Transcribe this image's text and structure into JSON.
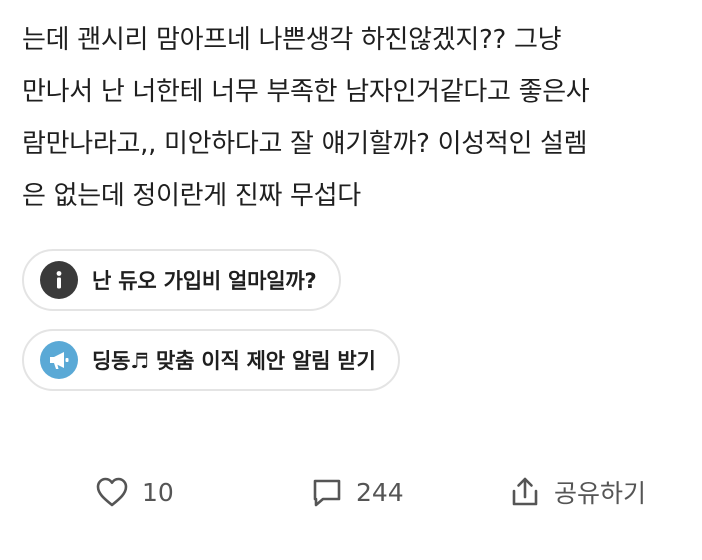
{
  "post": {
    "lines": [
      "는데 괜시리 맘아프네 나쁜생각 하진않겠지??  그냥",
      "만나서 난 너한테 너무 부족한 남자인거같다고 좋은사",
      "람만나라고,, 미안하다고 잘 얘기할까? 이성적인 설렘",
      "은 없는데 정이란게 진짜 무섭다"
    ]
  },
  "chips": [
    {
      "label": "난 듀오 가입비 얼마일까?",
      "icon": "info-icon",
      "icon_bg": "#3a3a3a"
    },
    {
      "label": "딩동♬ 맞춤 이직 제안 알림 받기",
      "icon": "megaphone-icon",
      "icon_bg": "#5aa9d6"
    }
  ],
  "actions": {
    "like": {
      "icon": "heart-icon",
      "count": "10"
    },
    "comment": {
      "icon": "comment-icon",
      "count": "244"
    },
    "share": {
      "icon": "share-icon",
      "label": "공유하기"
    }
  },
  "colors": {
    "text": "#1f1f1f",
    "muted": "#555555",
    "chip_border": "#e4e4e4"
  }
}
